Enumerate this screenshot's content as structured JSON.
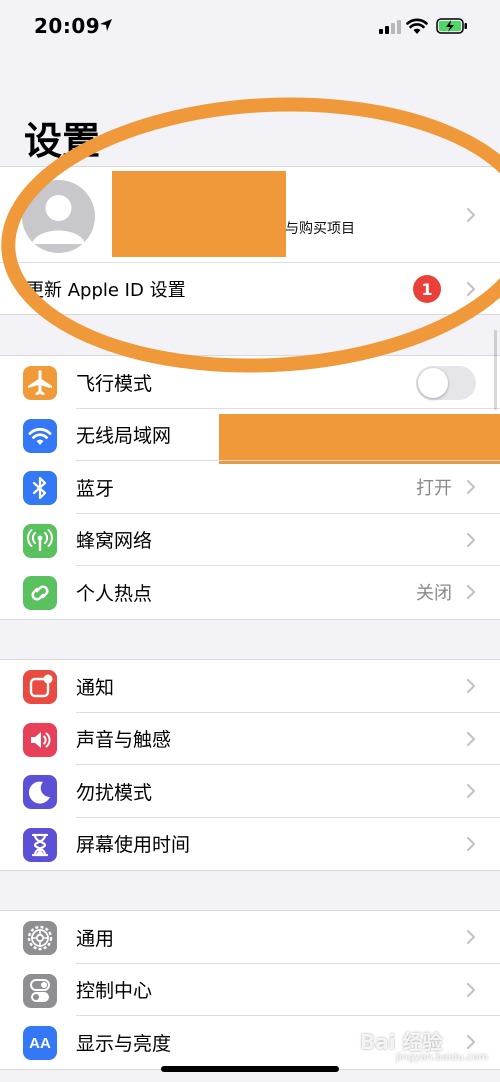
{
  "status": {
    "time": "20:09"
  },
  "title": "设置",
  "profile": {
    "subtitle": "与购买项目",
    "appleid_label": "更新 Apple ID 设置",
    "badge": "1"
  },
  "group1": [
    {
      "label": "飞行模式",
      "icon": "airplane-icon",
      "color": "#f19a38",
      "control": "toggle",
      "toggle_on": false
    },
    {
      "label": "无线局域网",
      "icon": "wifi-icon",
      "color": "#3478f6",
      "control": "redacted"
    },
    {
      "label": "蓝牙",
      "icon": "bluetooth-icon",
      "color": "#3478f6",
      "value": "打开"
    },
    {
      "label": "蜂窝网络",
      "icon": "cellular-icon",
      "color": "#5ac15f"
    },
    {
      "label": "个人热点",
      "icon": "hotspot-icon",
      "color": "#5ac15f",
      "value": "关闭"
    }
  ],
  "group2": [
    {
      "label": "通知",
      "icon": "notification-icon",
      "color": "#e94b40"
    },
    {
      "label": "声音与触感",
      "icon": "sound-icon",
      "color": "#e9405a"
    },
    {
      "label": "勿扰模式",
      "icon": "moon-icon",
      "color": "#5b50d6"
    },
    {
      "label": "屏幕使用时间",
      "icon": "hourglass-icon",
      "color": "#5b50d6"
    }
  ],
  "group3": [
    {
      "label": "通用",
      "icon": "gear-icon",
      "color": "#8e8e93"
    },
    {
      "label": "控制中心",
      "icon": "switches-icon",
      "color": "#8e8e93"
    },
    {
      "label": "显示与亮度",
      "icon": "display-icon",
      "color": "#3478f6",
      "glyph": "AA"
    }
  ],
  "watermark": {
    "text": "Bai 经验",
    "sub": "jingyan.baidu.com"
  },
  "colors": {
    "annotation": "#f0993a",
    "badge": "#e9413a",
    "background": "#f2f2f7"
  }
}
